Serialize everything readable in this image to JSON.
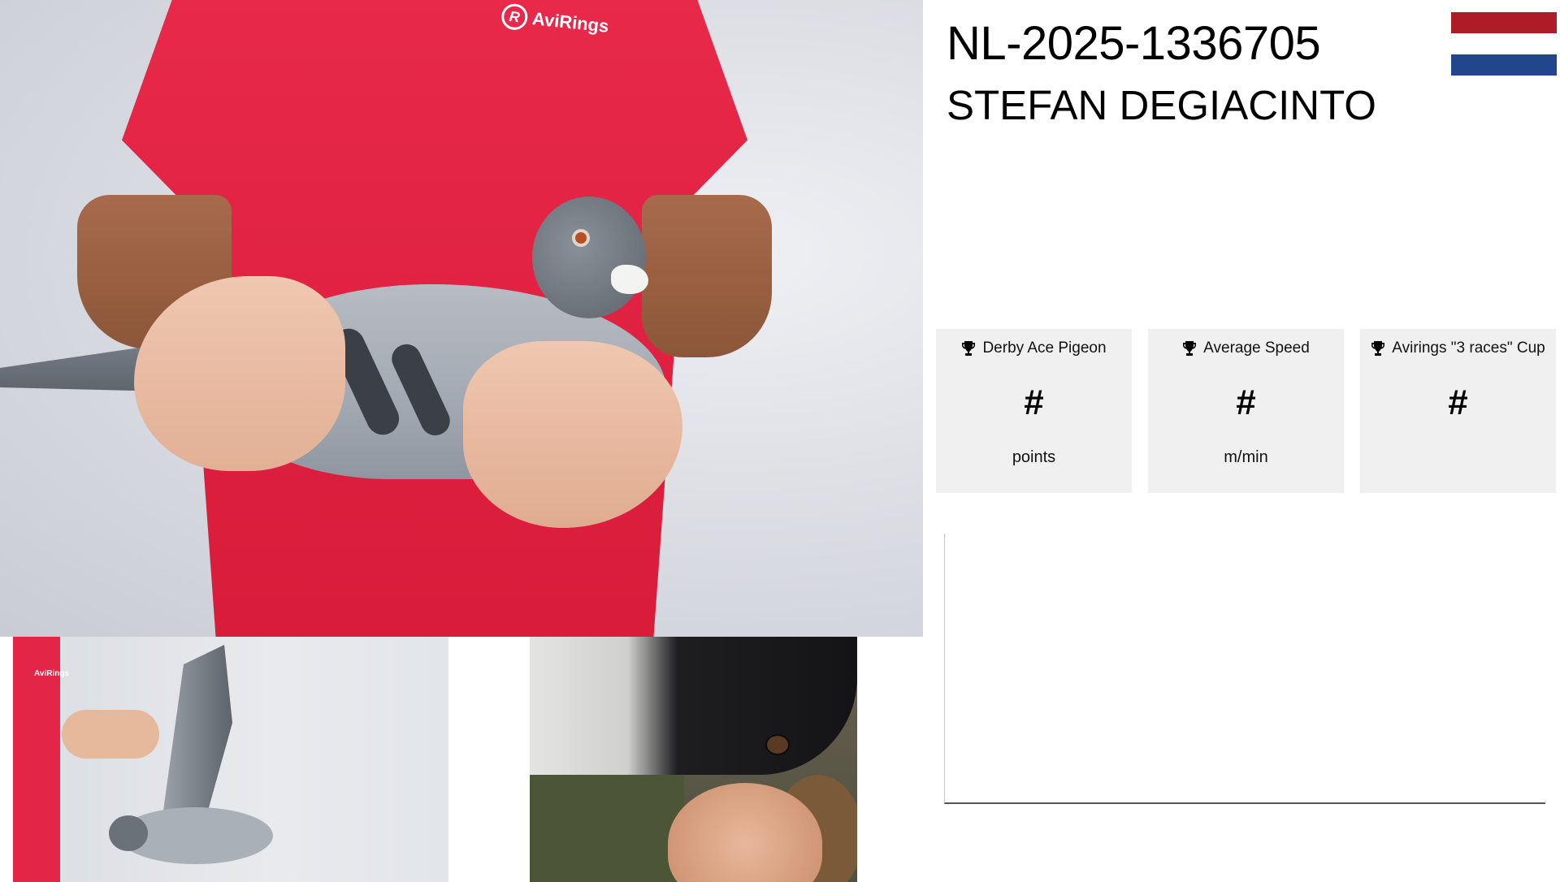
{
  "pigeon": {
    "ring_number": "NL-2025-1336705",
    "owner_name": "STEFAN DEGIACINTO",
    "country_flag": {
      "name": "netherlands-flag",
      "colors": [
        "#ae1c28",
        "#ffffff",
        "#21468b"
      ]
    }
  },
  "main_photo": {
    "shirt_logo": {
      "mark": "R",
      "text": "AviRings"
    }
  },
  "thumbnails": {
    "wing_photo": {
      "shirt_logo_text": "AviRings"
    }
  },
  "stats": [
    {
      "title": "Derby Ace Pigeon",
      "value": "#",
      "unit": "points",
      "icon": "trophy-icon"
    },
    {
      "title": "Average Speed",
      "value": "#",
      "unit": "m/min",
      "icon": "trophy-icon"
    },
    {
      "title": "Avirings \"3 races\" Cup",
      "value": "#",
      "unit": "",
      "icon": "trophy-icon"
    }
  ],
  "colors": {
    "accent_shirt": "#e32647",
    "card_background": "#f0f0f0"
  }
}
